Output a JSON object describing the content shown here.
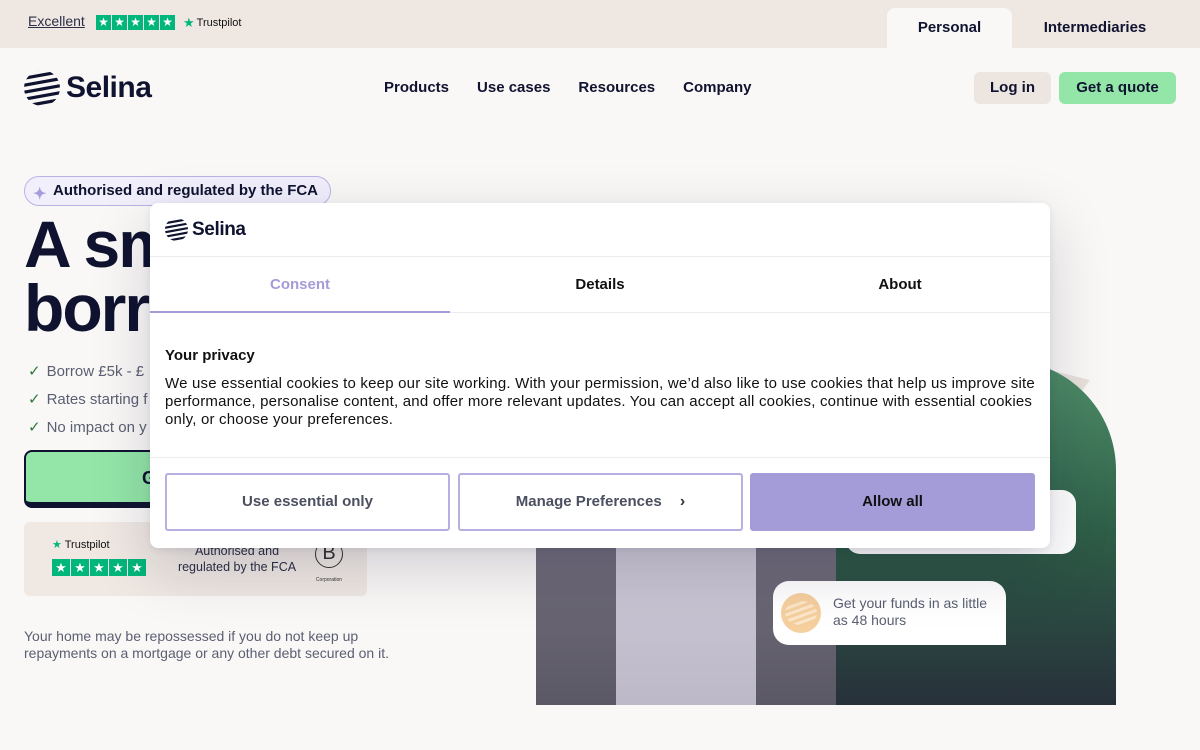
{
  "topbar": {
    "trustpilot_rating_text": "Excellent",
    "trustpilot_brand": "Trustpilot",
    "segments": {
      "personal": "Personal",
      "intermediaries": "Intermediaries"
    }
  },
  "header": {
    "logo_text": "Selina",
    "nav": [
      "Products",
      "Use cases",
      "Resources",
      "Company"
    ],
    "login_label": "Log in",
    "quote_label": "Get a quote"
  },
  "hero": {
    "badge": "Authorised and regulated by the FCA",
    "title_line1": "A sm",
    "title_line2": "borr",
    "checks": [
      "Borrow £5k - £",
      "Rates starting f",
      "No impact on y"
    ],
    "cta_partial": "G",
    "trust_strip": {
      "trustpilot": "Trustpilot",
      "fca_text": "Authorised and regulated by the FCA",
      "bcorp_caption": "Corporation"
    },
    "disclaimer": "Your home may be repossessed if you do not keep up repayments on a mortgage or any other debt secured on it.",
    "funds_card": "Get your funds in as little as 48 hours"
  },
  "modal": {
    "logo_text": "Selina",
    "tabs": [
      "Consent",
      "Details",
      "About"
    ],
    "active_tab": "Consent",
    "privacy_title": "Your privacy",
    "privacy_text": "We use essential cookies to keep our site working. With your permission, we’d also like to use cookies that help us improve site performance, personalise content, and offer more relevant updates. You can accept all cookies, continue with essential cookies only, or choose your preferences.",
    "buttons": {
      "essential": "Use essential only",
      "manage": "Manage Preferences",
      "allow": "Allow all"
    }
  },
  "colors": {
    "accent_green": "#93e6a8",
    "accent_purple": "#a49cd8",
    "trustpilot_green": "#00b67a",
    "navy": "#0f1330"
  },
  "icons": {
    "stars": "trustpilot-star-icon",
    "check": "check-icon",
    "chevron": "chevron-right-icon",
    "logo": "selina-logo-icon"
  }
}
